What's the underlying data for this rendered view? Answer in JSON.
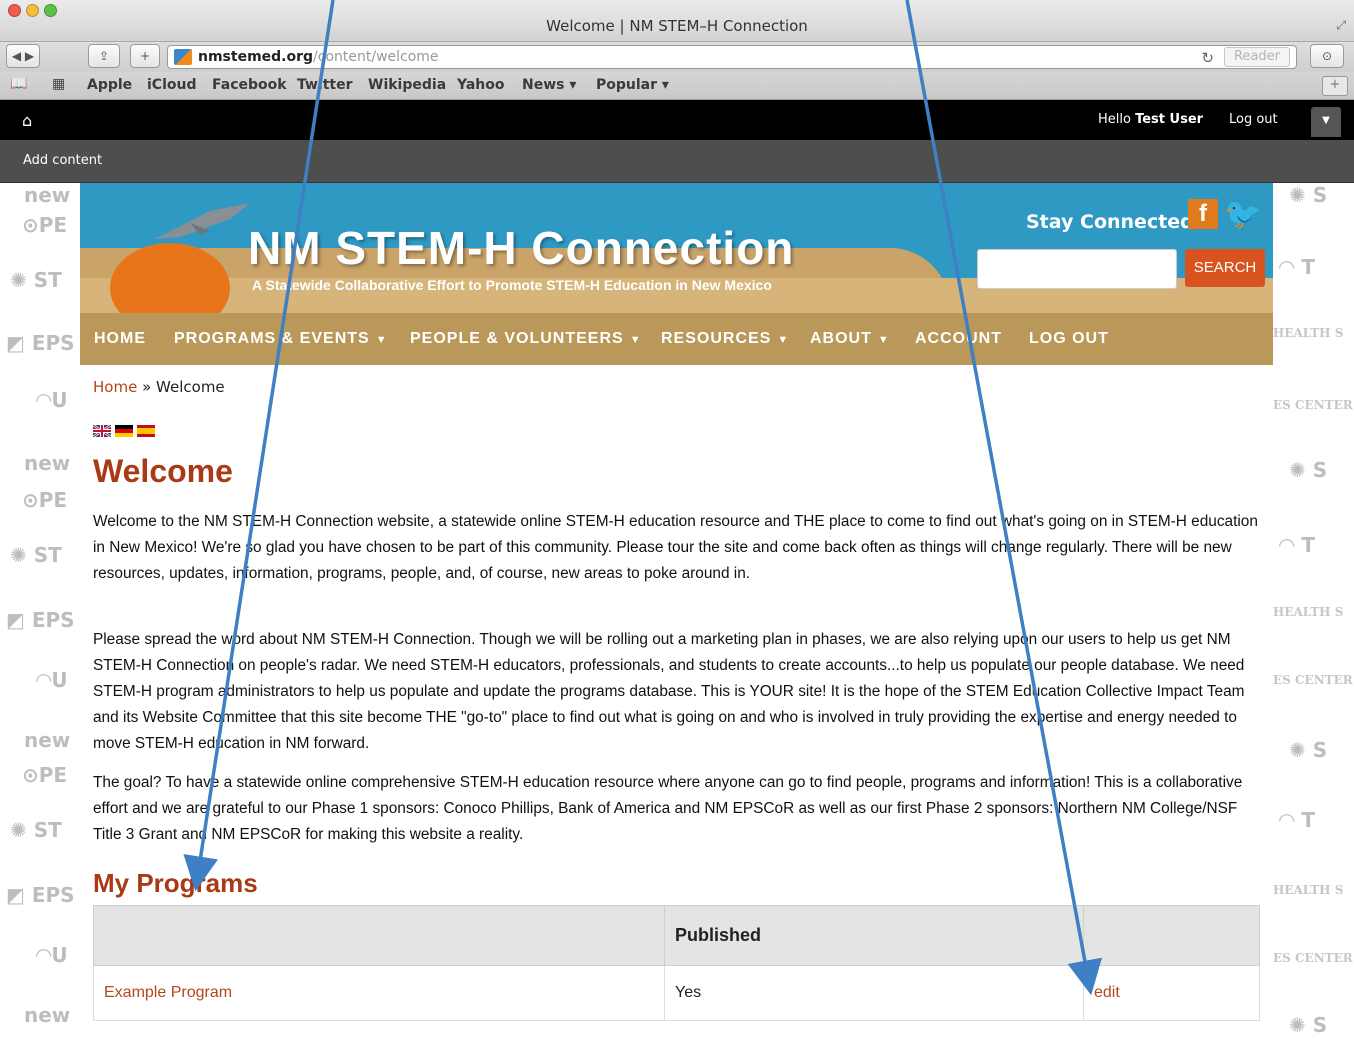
{
  "browser": {
    "window_title": "Welcome | NM STEM–H Connection",
    "url_host": "nmstemed.org",
    "url_path": "/content/welcome",
    "reader_label": "Reader",
    "bookmarks": [
      "Apple",
      "iCloud",
      "Facebook",
      "Twitter",
      "Wikipedia",
      "Yahoo",
      "News ▾",
      "Popular ▾"
    ],
    "icons": [
      "back-icon",
      "forward-icon",
      "share-icon",
      "new-tab-icon",
      "reload-icon",
      "downloads-icon",
      "reading-list-icon",
      "top-sites-icon"
    ]
  },
  "toolbar": {
    "hello_prefix": "Hello",
    "user_name": "Test User",
    "logout_label": "Log out",
    "add_content_label": "Add content"
  },
  "header": {
    "site_title": "NM STEM-H Connection",
    "slogan": "A Statewide Collaborative Effort to Promote STEM-H Education in New Mexico",
    "stay_connected": "Stay Connected:",
    "search_button": "SEARCH",
    "colors": {
      "banner": "#2e9ac4",
      "nav": "#b9985a",
      "accent": "#d9531e",
      "title": "#a83a16"
    }
  },
  "nav": {
    "items": [
      "HOME",
      "PROGRAMS & EVENTS",
      "PEOPLE & VOLUNTEERS",
      "RESOURCES",
      "ABOUT",
      "ACCOUNT",
      "LOG OUT"
    ]
  },
  "breadcrumb": {
    "home": "Home",
    "sep": "»",
    "current": "Welcome"
  },
  "page": {
    "title": "Welcome",
    "paragraphs": [
      "Welcome to the NM STEM-H Connection website, a statewide online STEM-H education resource and THE place to come to find out what's going on in STEM-H education in New Mexico! We're so glad you have chosen to be part of this community. Please tour the site and come back often as things will change regularly. There will be new resources, updates, information, programs, people, and, of course, new areas to poke around in.",
      "Please spread the word about NM STEM-H Connection. Though we will be rolling out a marketing plan in phases, we are also relying upon our users to help us get NM STEM-H Connection on people's radar. We need STEM-H educators, professionals, and students to create accounts...to help us populate our people database. We need STEM-H program administrators to help us populate and update the programs database. This is YOUR site! It is the hope of the STEM Education Collective Impact Team and its Website Committee that this site become THE \"go-to\" place to find out what is going on and who is involved in truly providing the expertise and energy needed to move STEM-H education in NM forward.",
      "The goal? To have a statewide online comprehensive STEM-H education resource where anyone can go to find people, programs and information! This is a collaborative effort and we are grateful to our Phase 1 sponsors: Conoco Phillips, Bank of America and NM EPSCoR as well as our first Phase 2 sponsors: Northern NM College/NSF Title 3 Grant and NM EPSCoR for making this website a reality."
    ],
    "my_programs_title": "My Programs",
    "table": {
      "headers": [
        "",
        "Published",
        ""
      ],
      "rows": [
        {
          "name": "Example Program",
          "published": "Yes",
          "action": "edit"
        }
      ]
    }
  },
  "sidebar_watermarks": {
    "left": [
      "new mexico",
      "PED",
      "STEM Action",
      "New EPSCoR",
      "UNM"
    ],
    "right": [
      "HEALTH SCIENCES Office for Diversity",
      "SCIENCES CENTER",
      "THE New"
    ]
  }
}
